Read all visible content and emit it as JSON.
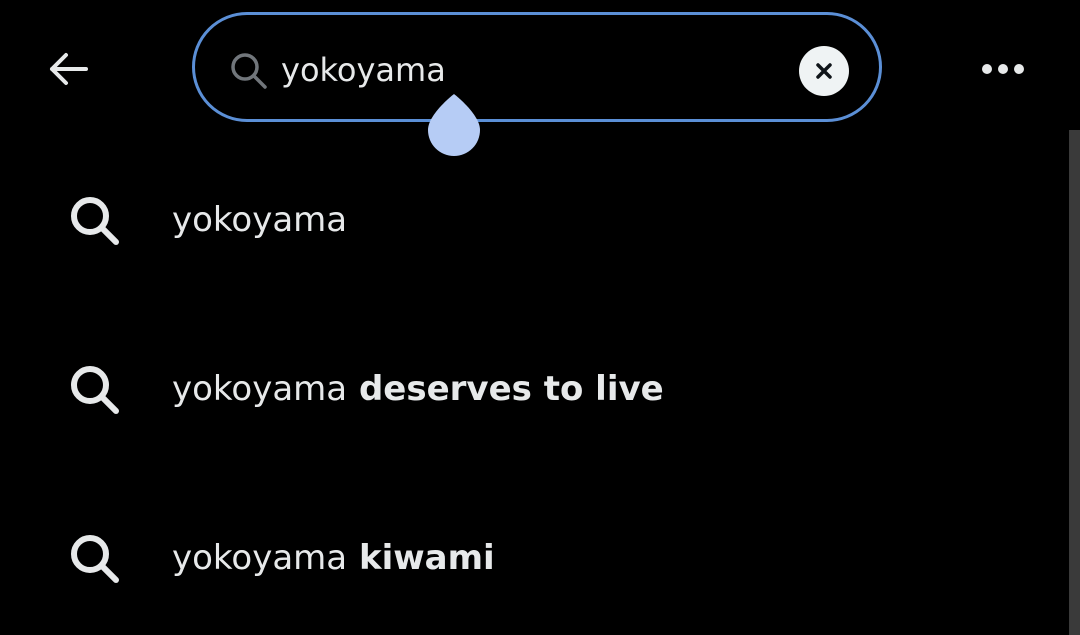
{
  "header": {
    "back_icon": "arrow-left-icon",
    "more_icon": "more-horizontal-icon"
  },
  "search": {
    "value": "yokoyama",
    "search_icon": "search-icon",
    "clear_icon": "close-icon",
    "border_color": "#5b8fd6",
    "handle_color": "#b6ccf5"
  },
  "suggestions": [
    {
      "query": "yokoyama",
      "completion": ""
    },
    {
      "query": "yokoyama",
      "completion": " deserves to live"
    },
    {
      "query": "yokoyama",
      "completion": " kiwami"
    }
  ],
  "colors": {
    "background": "#000000",
    "text": "#e7e9ea",
    "icon_muted": "#71767b"
  }
}
